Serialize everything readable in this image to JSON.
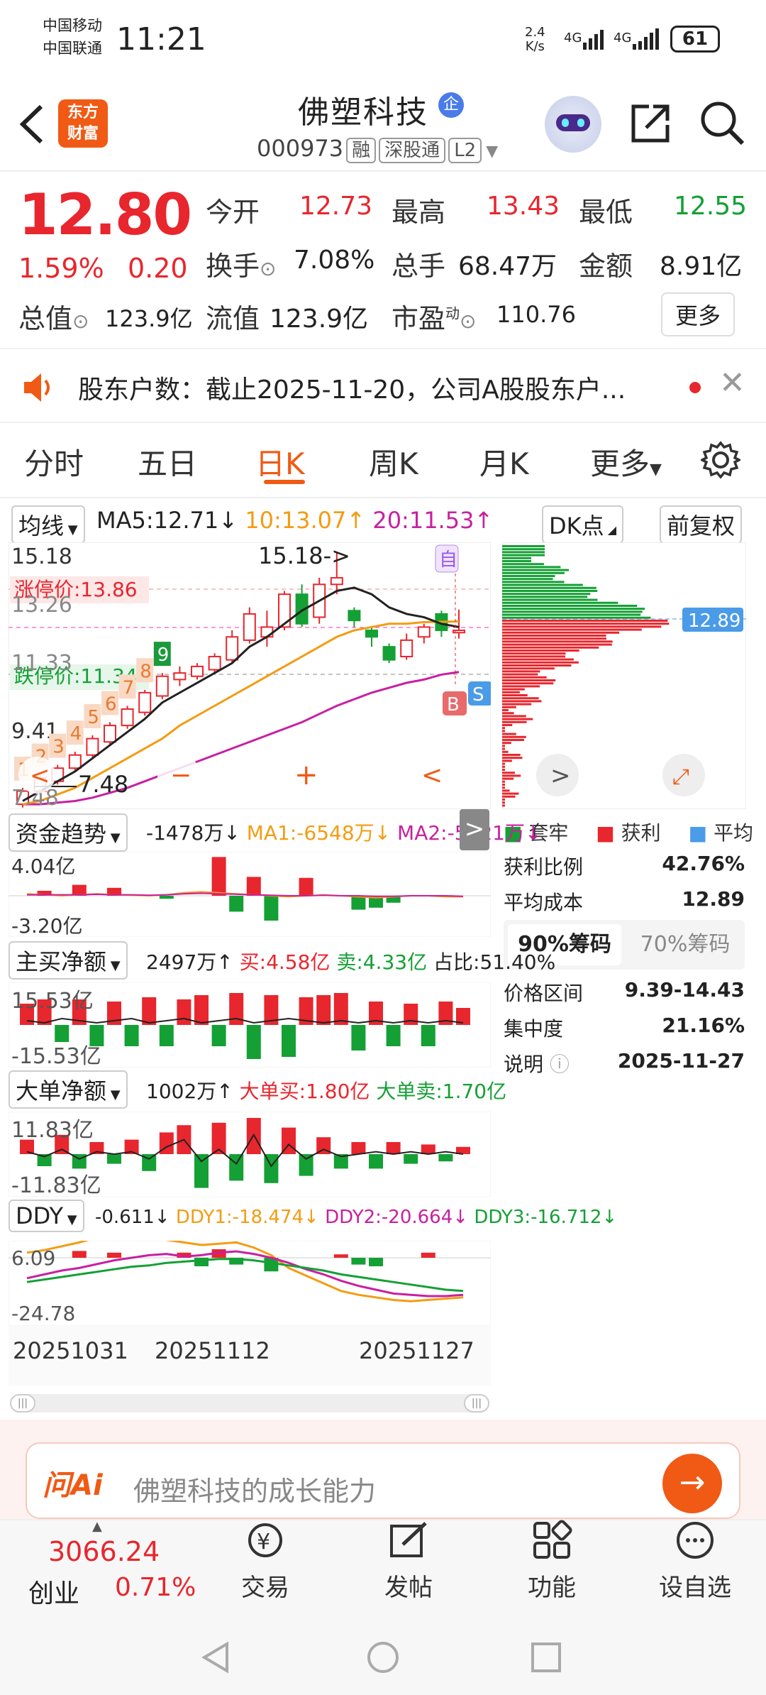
{
  "status": {
    "carrier1": "中国移动",
    "carrier2": "中国联通",
    "time": "11:21",
    "net_speed": "2.4\nK/s",
    "net_speed_top": "2.4",
    "net_speed_bottom": "K/s",
    "sig1": "4G",
    "sig2": "4G",
    "battery": "61"
  },
  "header": {
    "logo_line1": "东方",
    "logo_line2": "财富",
    "stock_name": "佛塑科技",
    "ent_badge": "企",
    "code": "000973",
    "tags": [
      "融",
      "深股通",
      "L2"
    ]
  },
  "quote": {
    "price": "12.80",
    "pct": "1.59%",
    "change": "0.20",
    "open_label": "今开",
    "open": "12.73",
    "high_label": "最高",
    "high": "13.43",
    "low_label": "最低",
    "low": "12.55",
    "turnover_label": "换手",
    "turnover": "7.08%",
    "volume_label": "总手",
    "volume": "68.47万",
    "amount_label": "金额",
    "amount": "8.91亿",
    "mcap_label": "总值",
    "mcap": "123.9亿",
    "float_label": "流值",
    "float": "123.9亿",
    "pe_label": "市盈",
    "pe_sup": "动",
    "pe": "110.76",
    "more": "更多"
  },
  "notice": {
    "text": "股东户数：截止2025-11-20，公司A股股东户..."
  },
  "tabs": [
    "分时",
    "五日",
    "日K",
    "周K",
    "月K",
    "更多"
  ],
  "active_tab": "日K",
  "ma_bar": {
    "selector": "均线",
    "ma5": "MA5:12.71↓",
    "ma10": "10:13.07↑",
    "ma20": "20:11.53↑",
    "dk": "DK点",
    "fq": "前复权"
  },
  "kline": {
    "y_top": "15.18",
    "y_mid1": "13.26",
    "y_mid2": "11.33",
    "y_mid3": "9.41",
    "y_low": "7.48",
    "peak_label": "15.18->",
    "low_label": "7.48",
    "limit_up": "涨停价:13.86",
    "limit_down": "跌停价:11.34",
    "auto_tag": "自",
    "b_tag": "B",
    "s_tag": "S",
    "seq": [
      "1",
      "2",
      "3",
      "4",
      "5",
      "6",
      "7",
      "8",
      "9"
    ]
  },
  "chip": {
    "price_tag": "12.89",
    "legend": [
      "套牢",
      "获利",
      "平均"
    ],
    "rows": [
      {
        "label": "获利比例",
        "value": "42.76%"
      },
      {
        "label": "平均成本",
        "value": "12.89"
      }
    ],
    "tab1": "90%筹码",
    "tab2": "70%筹码",
    "rows2": [
      {
        "label": "价格区间",
        "value": "9.39-14.43"
      },
      {
        "label": "集中度",
        "value": "21.16%"
      },
      {
        "label": "说明",
        "value": "2025-11-27"
      }
    ]
  },
  "ind1": {
    "name": "资金趋势",
    "v": "-1478万↓",
    "ma1": "MA1:-6548万↓",
    "ma2": "MA2:-5021万↓",
    "top": "4.04亿",
    "bottom": "-3.20亿"
  },
  "ind2": {
    "name": "主买净额",
    "v": "2497万↑",
    "buy": "买:4.58亿",
    "sell": "卖:4.33亿",
    "ratio": "占比:51.40%",
    "top": "15.53亿",
    "bottom": "-15.53亿"
  },
  "ind3": {
    "name": "大单净额",
    "v": "1002万↑",
    "buy": "大单买:1.80亿",
    "sell": "大单卖:1.70亿",
    "top": "11.83亿",
    "bottom": "-11.83亿"
  },
  "ind4": {
    "name": "DDY",
    "v": "-0.611↓",
    "d1": "DDY1:-18.474↓",
    "d2": "DDY2:-20.664↓",
    "d3": "DDY3:-16.712↓",
    "top": "6.09",
    "bottom": "-24.78"
  },
  "dates": [
    "20251031",
    "20251112",
    "20251127"
  ],
  "ai": {
    "logo": "问Ai",
    "prompt": "佛塑科技的成长能力"
  },
  "bottom_nav": {
    "index_value": "3066.24",
    "index_name": "创业",
    "index_pct": "0.71%",
    "items": [
      "交易",
      "发帖",
      "功能",
      "设自选"
    ]
  },
  "colors": {
    "up": "#e8262d",
    "down": "#14a034",
    "ma5": "#222222",
    "ma10": "#f39c12",
    "ma20": "#c820a0",
    "accent": "#f05a14"
  }
}
